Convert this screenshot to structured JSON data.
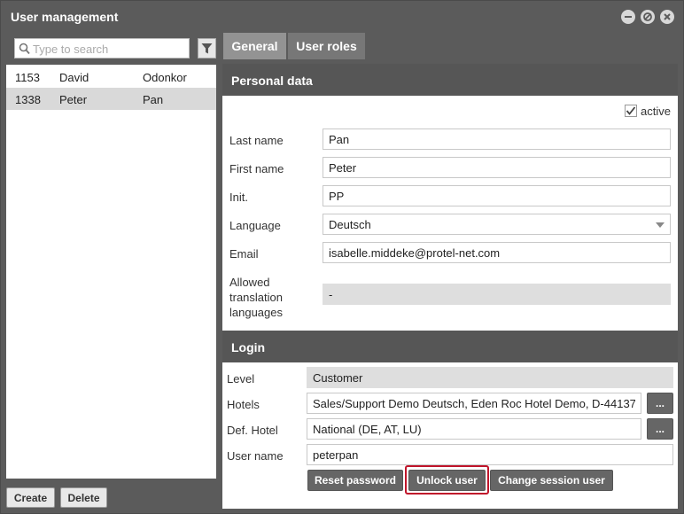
{
  "window": {
    "title": "User management"
  },
  "search": {
    "placeholder": "Type to search"
  },
  "users": [
    {
      "id": "1153",
      "first": "David",
      "last": "Odonkor",
      "selected": false
    },
    {
      "id": "1338",
      "first": "Peter",
      "last": "Pan",
      "selected": true
    }
  ],
  "list_actions": {
    "create": "Create",
    "delete": "Delete"
  },
  "tabs": [
    {
      "label": "General",
      "active": true
    },
    {
      "label": "User roles",
      "active": false
    }
  ],
  "personal": {
    "heading": "Personal data",
    "active_label": "active",
    "active_checked": true,
    "last_name_label": "Last name",
    "last_name": "Pan",
    "first_name_label": "First name",
    "first_name": "Peter",
    "init_label": "Init.",
    "init": "PP",
    "language_label": "Language",
    "language": "Deutsch",
    "email_label": "Email",
    "email": "isabelle.middeke@protel-net.com",
    "allowed_label_1": "Allowed",
    "allowed_label_2": "translation",
    "allowed_label_3": "languages",
    "allowed_value": "-"
  },
  "login": {
    "heading": "Login",
    "level_label": "Level",
    "level": "Customer",
    "hotels_label": "Hotels",
    "hotels": "Sales/Support Demo Deutsch, Eden Roc Hotel Demo, D-44137",
    "def_hotel_label": "Def. Hotel",
    "def_hotel": "National (DE, AT, LU)",
    "username_label": "User name",
    "username": "peterpan",
    "dots": "...",
    "reset_password": "Reset password",
    "unlock_user": "Unlock user",
    "change_session_user": "Change session user"
  },
  "colors": {
    "window_bg": "#5b5b5b",
    "section_head": "#565656",
    "button_dark": "#666666",
    "highlight": "#c0152b"
  },
  "icons": [
    "minimize-icon",
    "restore-icon",
    "close-icon",
    "search-icon",
    "filter-icon",
    "checkmark-icon",
    "chevron-down-icon"
  ]
}
